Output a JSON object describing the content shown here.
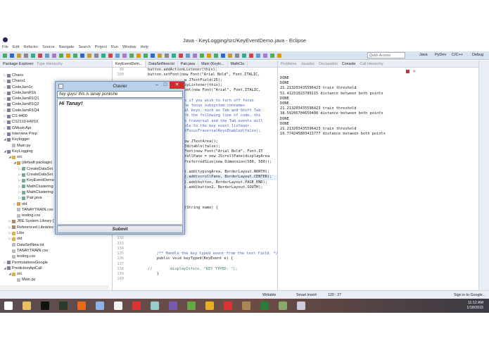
{
  "window": {
    "title": "Java - KeyLogging/src/KeyEventDemo.java - Eclipse"
  },
  "menu": [
    "File",
    "Edit",
    "Refactor",
    "Source",
    "Navigate",
    "Search",
    "Project",
    "Run",
    "Window",
    "Help"
  ],
  "toolbar": {
    "quick_access_placeholder": "Quick Access",
    "perspectives": [
      "Java",
      "PyDev",
      "C/C++",
      "Debug"
    ]
  },
  "package_explorer": {
    "tabs": [
      "Package Explorer",
      "Type Hierarchy"
    ],
    "items": [
      {
        "label": "Chaos",
        "level": 0,
        "icon": "project",
        "expanded": false
      },
      {
        "label": "Chaos1",
        "level": 0,
        "icon": "project",
        "expanded": false
      },
      {
        "label": "CodeJam1c",
        "level": 0,
        "icon": "project",
        "expanded": false
      },
      {
        "label": "CodeJamR1b",
        "level": 0,
        "icon": "project",
        "expanded": false
      },
      {
        "label": "CodeJamR1Q1",
        "level": 0,
        "icon": "project",
        "expanded": false
      },
      {
        "label": "CodeJamR1Q2",
        "level": 0,
        "icon": "project",
        "expanded": false
      },
      {
        "label": "CodeJamR1Q4",
        "level": 0,
        "icon": "project",
        "expanded": false
      },
      {
        "label": "CS 4400",
        "level": 0,
        "icon": "project",
        "expanded": false
      },
      {
        "label": "CS2110-HW10",
        "level": 0,
        "icon": "project",
        "expanded": false
      },
      {
        "label": "GMusicApi",
        "level": 0,
        "icon": "project",
        "expanded": false
      },
      {
        "label": "Interview Prep",
        "level": 0,
        "icon": "project",
        "expanded": false
      },
      {
        "label": "Keylogger",
        "level": 0,
        "icon": "project",
        "expanded": true
      },
      {
        "label": "Main.py",
        "level": 1,
        "icon": "file",
        "expanded": null
      },
      {
        "label": "KeyLogging",
        "level": 0,
        "icon": "project",
        "expanded": true
      },
      {
        "label": "src",
        "level": 1,
        "icon": "folder",
        "expanded": true
      },
      {
        "label": "(default package)",
        "level": 2,
        "icon": "package",
        "expanded": true
      },
      {
        "label": "CreateDataSet",
        "level": 3,
        "icon": "java",
        "expanded": false
      },
      {
        "label": "CreateDataSet",
        "level": 3,
        "icon": "java",
        "expanded": false
      },
      {
        "label": "KeyEventDemo",
        "level": 3,
        "icon": "java",
        "expanded": false
      },
      {
        "label": "MathClustering",
        "level": 3,
        "icon": "java",
        "expanded": false
      },
      {
        "label": "MathClustering",
        "level": 3,
        "icon": "java",
        "expanded": false
      },
      {
        "label": "Pair.java",
        "level": 3,
        "icon": "java",
        "expanded": false
      },
      {
        "label": "old",
        "level": 2,
        "icon": "package",
        "expanded": false
      },
      {
        "label": "TANAYTRAIN.csv",
        "level": 2,
        "icon": "file",
        "expanded": null
      },
      {
        "label": "testing.csv",
        "level": 2,
        "icon": "file",
        "expanded": null
      },
      {
        "label": "JRE System Library [",
        "level": 1,
        "icon": "library",
        "expanded": false
      },
      {
        "label": "Referenced Libraries",
        "level": 1,
        "icon": "library",
        "expanded": false
      },
      {
        "label": "Libs",
        "level": 1,
        "icon": "folder",
        "expanded": false
      },
      {
        "label": "old",
        "level": 1,
        "icon": "folder",
        "expanded": false
      },
      {
        "label": "DataSetNew.txt",
        "level": 1,
        "icon": "file",
        "expanded": null
      },
      {
        "label": "TANAYTRAIN.csv",
        "level": 1,
        "icon": "file",
        "expanded": null
      },
      {
        "label": "testing.csv",
        "level": 1,
        "icon": "file",
        "expanded": null
      },
      {
        "label": "PermutationsGoogle",
        "level": 0,
        "icon": "project",
        "expanded": false
      },
      {
        "label": "PredictionApiCall",
        "level": 0,
        "icon": "project",
        "expanded": true
      },
      {
        "label": "src",
        "level": 1,
        "icon": "folder",
        "expanded": true
      },
      {
        "label": "Main.py",
        "level": 2,
        "icon": "file",
        "expanded": null
      }
    ]
  },
  "editor": {
    "tabs": [
      "KeyEventDem...",
      "DataSetNew.txt",
      "Pair.java",
      "Main (Keylo...",
      "MathClu"
    ],
    "lines": [
      {
        "n": "99",
        "t": "button.addActionListener(this);",
        "k": ""
      },
      {
        "n": "100",
        "t": "button.setFont(new Font(\"Arial Bold\", Font.ITALIC,",
        "k": ""
      },
      {
        "n": "",
        "t": "w JTextField(25);",
        "k": "frag"
      },
      {
        "n": "",
        "t": "eyListener(this);",
        "k": "frag"
      },
      {
        "n": "",
        "t": "ont(new Font(\"Arial\", Font.ITALIC,",
        "k": "frag"
      },
      {
        "n": "",
        "t": "",
        "k": "frag"
      },
      {
        "n": "",
        "t": "s if you wish to turn off focus",
        "k": "frag cm"
      },
      {
        "n": "",
        "t": "he focus subsystem consumes",
        "k": "frag cm"
      },
      {
        "n": "",
        "t": "al keys, such as Tab and Shift Tab.",
        "k": "frag cm"
      },
      {
        "n": "",
        "t": "nt the following line of code, thi",
        "k": "frag cm"
      },
      {
        "n": "",
        "t": "s traversal and the Tab events will",
        "k": "frag cm"
      },
      {
        "n": "",
        "t": "ble to the key event listener.",
        "k": "frag cm"
      },
      {
        "n": "",
        "t": "tFocusTraversalKeysEnabled(false);",
        "k": "frag cm"
      },
      {
        "n": "",
        "t": "",
        "k": "frag"
      },
      {
        "n": "",
        "t": "ew JTextArea();",
        "k": "frag"
      },
      {
        "n": "",
        "t": "Editable(false);",
        "k": "frag"
      },
      {
        "n": "",
        "t": "Font(new Font(\"Arial Bold\", Font.IT",
        "k": "frag"
      },
      {
        "n": "",
        "t": "rollPane = new JScrollPane(displayArea",
        "k": "frag"
      },
      {
        "n": "",
        "t": "PreferredSize(new Dimension(500, 500));",
        "k": "frag"
      },
      {
        "n": "",
        "t": "",
        "k": "frag"
      },
      {
        "n": "",
        "t": ").add(typingArea, BorderLayout.NORTH);",
        "k": "frag"
      },
      {
        "n": "",
        "t": ").add(scrollPane, BorderLayout.CENTER);",
        "k": "frag hl"
      },
      {
        "n": "",
        "t": ").add(button, BorderLayout.PAGE_END);",
        "k": "frag"
      },
      {
        "n": "",
        "t": ").add(button2, BorderLayout.SOUTH);",
        "k": "frag"
      },
      {
        "n": "",
        "t": "",
        "k": "frag"
      },
      {
        "n": "",
        "t": "",
        "k": "frag"
      },
      {
        "n": "",
        "t": "",
        "k": "frag"
      },
      {
        "n": "",
        "t": "(String name) {",
        "k": "frag"
      },
      {
        "n": "",
        "t": "",
        "k": "frag"
      },
      {
        "n": "",
        "t": "",
        "k": "frag"
      },
      {
        "n": "",
        "t": "",
        "k": "frag"
      },
      {
        "n": "",
        "t": "",
        "k": "frag"
      },
      {
        "n": "",
        "t": "",
        "k": "frag"
      },
      {
        "n": "132",
        "t": "",
        "k": ""
      },
      {
        "n": "133",
        "t": "",
        "k": ""
      },
      {
        "n": "134",
        "t": "",
        "k": ""
      },
      {
        "n": "135",
        "t": "    /** Handle the key typed event from the text field. */",
        "k": "cm"
      },
      {
        "n": "136",
        "t": "    public void keyTyped(KeyEvent e) {",
        "k": ""
      },
      {
        "n": "137",
        "t": "",
        "k": ""
      },
      {
        "n": "138",
        "t": "//        displayInfo(e, \"KEY TYPED: \");",
        "k": "sl"
      },
      {
        "n": "139",
        "t": "    }",
        "k": ""
      },
      {
        "n": "140",
        "t": "",
        "k": ""
      }
    ]
  },
  "console": {
    "tabs": [
      "Problems",
      "Javadoc",
      "Declaration",
      "Console",
      "Call Hierarchy"
    ],
    "output": "DONE\nDONE\n21.213203435596423 train threshold\n51.41231023789115 distance between both points\nDONE\nDONE\n21.213203435596423 train threshold\n38.59206704650408 distance between both points\nDONE\nDONE\n21.213203435596423 train threshold\n10.774245803413777 distance between both points"
  },
  "statusbar": {
    "writable": "Writable",
    "insert_mode": "Smart Insert",
    "position": "120 : 27",
    "sign_in": "Sign in to Google..."
  },
  "clavier": {
    "title": "Clavier",
    "input_value": "hey guys! this is tanay ponkshe",
    "display_text": "Hi Tanay!",
    "submit_label": "Submit"
  },
  "taskbar": {
    "time": "11:12 AM",
    "date": "1/18/2015"
  },
  "colors": {
    "accent": "#d8e3f2",
    "close": "#c9302c"
  }
}
